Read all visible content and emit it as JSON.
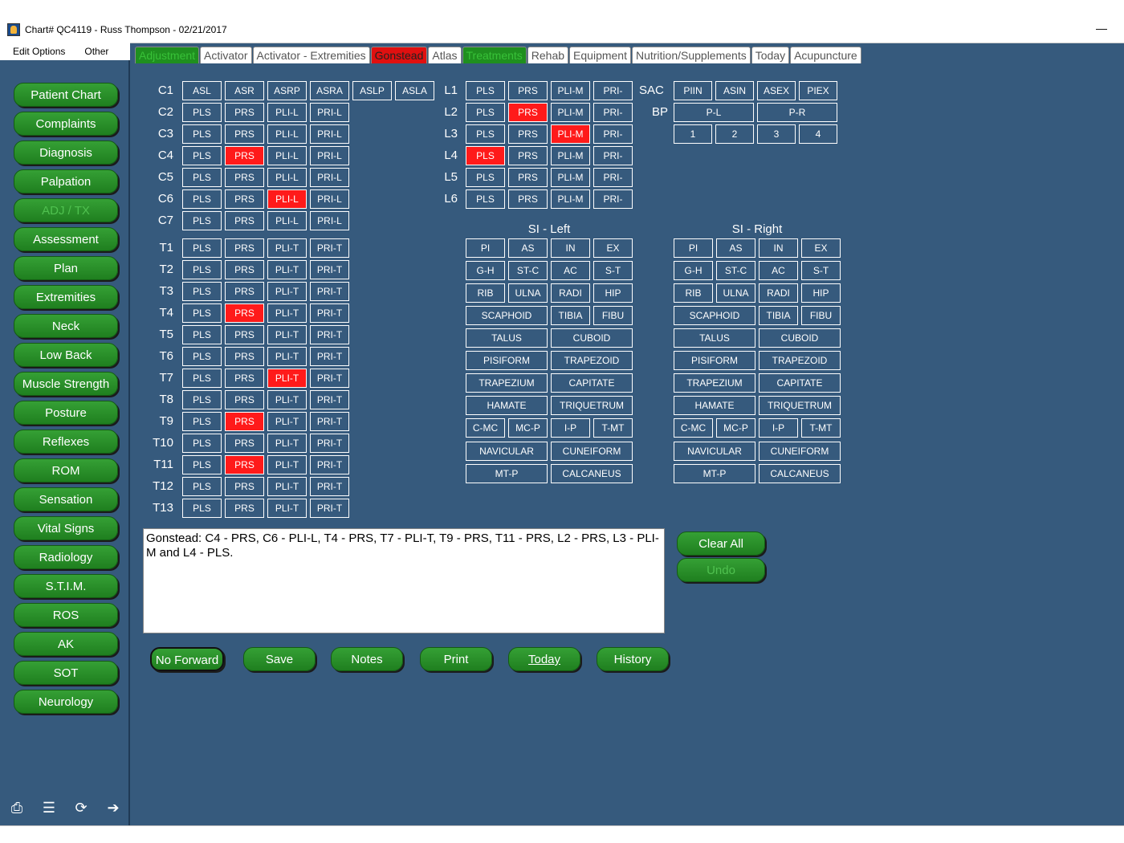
{
  "window": {
    "title": "Chart# QC4119 - Russ Thompson - 02/21/2017",
    "minimize": "—"
  },
  "menu": {
    "items": [
      "Edit Options",
      "Other"
    ]
  },
  "sidebar": {
    "items": [
      {
        "label": "Patient Chart"
      },
      {
        "label": "Complaints"
      },
      {
        "label": "Diagnosis"
      },
      {
        "label": "Palpation"
      },
      {
        "label": "ADJ / TX",
        "disabled": true
      },
      {
        "label": "Assessment"
      },
      {
        "label": "Plan"
      },
      {
        "label": "Extremities"
      },
      {
        "label": "Neck"
      },
      {
        "label": "Low Back"
      },
      {
        "label": "Muscle Strength"
      },
      {
        "label": "Posture"
      },
      {
        "label": "Reflexes"
      },
      {
        "label": "ROM"
      },
      {
        "label": "Sensation"
      },
      {
        "label": "Vital Signs"
      },
      {
        "label": "Radiology"
      },
      {
        "label": "S.T.I.M."
      },
      {
        "label": "ROS"
      },
      {
        "label": "AK"
      },
      {
        "label": "SOT"
      },
      {
        "label": "Neurology"
      }
    ],
    "bottom_icons": [
      "printer-icon",
      "list-icon",
      "refresh-icon",
      "arrow-right-icon"
    ]
  },
  "tabs": [
    {
      "label": "Adjustment",
      "style": "green"
    },
    {
      "label": "Activator"
    },
    {
      "label": "Activator - Extremities"
    },
    {
      "label": "Gonstead",
      "style": "red",
      "active": true
    },
    {
      "label": "Atlas"
    },
    {
      "label": "Treatments",
      "style": "green"
    },
    {
      "label": "Rehab"
    },
    {
      "label": "Equipment"
    },
    {
      "label": "Nutrition/Supplements"
    },
    {
      "label": "Today"
    },
    {
      "label": "Acupuncture"
    }
  ],
  "cervical": [
    {
      "label": "C1",
      "cells": [
        "ASL",
        "ASR",
        "ASRP",
        "ASRA",
        "ASLP",
        "ASLA"
      ],
      "selected": []
    },
    {
      "label": "C2",
      "cells": [
        "PLS",
        "PRS",
        "PLI-L",
        "PRI-L"
      ],
      "selected": []
    },
    {
      "label": "C3",
      "cells": [
        "PLS",
        "PRS",
        "PLI-L",
        "PRI-L"
      ],
      "selected": []
    },
    {
      "label": "C4",
      "cells": [
        "PLS",
        "PRS",
        "PLI-L",
        "PRI-L"
      ],
      "selected": [
        1
      ]
    },
    {
      "label": "C5",
      "cells": [
        "PLS",
        "PRS",
        "PLI-L",
        "PRI-L"
      ],
      "selected": []
    },
    {
      "label": "C6",
      "cells": [
        "PLS",
        "PRS",
        "PLI-L",
        "PRI-L"
      ],
      "selected": [
        2
      ]
    },
    {
      "label": "C7",
      "cells": [
        "PLS",
        "PRS",
        "PLI-L",
        "PRI-L"
      ],
      "selected": []
    }
  ],
  "thoracic": [
    {
      "label": "T1",
      "cells": [
        "PLS",
        "PRS",
        "PLI-T",
        "PRI-T"
      ],
      "selected": []
    },
    {
      "label": "T2",
      "cells": [
        "PLS",
        "PRS",
        "PLI-T",
        "PRI-T"
      ],
      "selected": []
    },
    {
      "label": "T3",
      "cells": [
        "PLS",
        "PRS",
        "PLI-T",
        "PRI-T"
      ],
      "selected": []
    },
    {
      "label": "T4",
      "cells": [
        "PLS",
        "PRS",
        "PLI-T",
        "PRI-T"
      ],
      "selected": [
        1
      ]
    },
    {
      "label": "T5",
      "cells": [
        "PLS",
        "PRS",
        "PLI-T",
        "PRI-T"
      ],
      "selected": []
    },
    {
      "label": "T6",
      "cells": [
        "PLS",
        "PRS",
        "PLI-T",
        "PRI-T"
      ],
      "selected": []
    },
    {
      "label": "T7",
      "cells": [
        "PLS",
        "PRS",
        "PLI-T",
        "PRI-T"
      ],
      "selected": [
        2
      ]
    },
    {
      "label": "T8",
      "cells": [
        "PLS",
        "PRS",
        "PLI-T",
        "PRI-T"
      ],
      "selected": []
    },
    {
      "label": "T9",
      "cells": [
        "PLS",
        "PRS",
        "PLI-T",
        "PRI-T"
      ],
      "selected": [
        1
      ]
    },
    {
      "label": "T10",
      "cells": [
        "PLS",
        "PRS",
        "PLI-T",
        "PRI-T"
      ],
      "selected": []
    },
    {
      "label": "T11",
      "cells": [
        "PLS",
        "PRS",
        "PLI-T",
        "PRI-T"
      ],
      "selected": [
        1
      ]
    },
    {
      "label": "T12",
      "cells": [
        "PLS",
        "PRS",
        "PLI-T",
        "PRI-T"
      ],
      "selected": []
    },
    {
      "label": "T13",
      "cells": [
        "PLS",
        "PRS",
        "PLI-T",
        "PRI-T"
      ],
      "selected": []
    }
  ],
  "lumbar": [
    {
      "label": "L1",
      "cells": [
        "PLS",
        "PRS",
        "PLI-M",
        "PRI-"
      ],
      "selected": []
    },
    {
      "label": "L2",
      "cells": [
        "PLS",
        "PRS",
        "PLI-M",
        "PRI-"
      ],
      "selected": [
        1
      ]
    },
    {
      "label": "L3",
      "cells": [
        "PLS",
        "PRS",
        "PLI-M",
        "PRI-"
      ],
      "selected": [
        2
      ]
    },
    {
      "label": "L4",
      "cells": [
        "PLS",
        "PRS",
        "PLI-M",
        "PRI-"
      ],
      "selected": [
        0
      ]
    },
    {
      "label": "L5",
      "cells": [
        "PLS",
        "PRS",
        "PLI-M",
        "PRI-"
      ],
      "selected": []
    },
    {
      "label": "L6",
      "cells": [
        "PLS",
        "PRS",
        "PLI-M",
        "PRI-"
      ],
      "selected": []
    }
  ],
  "sacrum": {
    "sac_label": "SAC",
    "sac_cells": [
      "PIIN",
      "ASIN",
      "ASEX",
      "PIEX"
    ],
    "bp_label": "BP",
    "bp_cells": [
      "P-L",
      "P-R"
    ],
    "num_cells": [
      "1",
      "2",
      "3",
      "4"
    ]
  },
  "si_left": {
    "title": "SI - Left",
    "rows": [
      [
        "PI",
        "AS",
        "IN",
        "EX"
      ],
      [
        "G-H",
        "ST-C",
        "AC",
        "S-T"
      ],
      [
        "RIB",
        "ULNA",
        "RADI",
        "HIP"
      ],
      [
        "SCAPHOID",
        "TIBIA",
        "FIBU"
      ],
      [
        "TALUS",
        "CUBOID"
      ],
      [
        "PISIFORM",
        "TRAPEZOID"
      ],
      [
        "TRAPEZIUM",
        "CAPITATE"
      ],
      [
        "HAMATE",
        "TRIQUETRUM"
      ],
      [
        "C-MC",
        "MC-P",
        "I-P",
        "T-MT"
      ],
      [
        "NAVICULAR",
        "CUNEIFORM"
      ],
      [
        "MT-P",
        "CALCANEUS"
      ]
    ]
  },
  "si_right": {
    "title": "SI - Right",
    "rows": [
      [
        "PI",
        "AS",
        "IN",
        "EX"
      ],
      [
        "G-H",
        "ST-C",
        "AC",
        "S-T"
      ],
      [
        "RIB",
        "ULNA",
        "RADI",
        "HIP"
      ],
      [
        "SCAPHOID",
        "TIBIA",
        "FIBU"
      ],
      [
        "TALUS",
        "CUBOID"
      ],
      [
        "PISIFORM",
        "TRAPEZOID"
      ],
      [
        "TRAPEZIUM",
        "CAPITATE"
      ],
      [
        "HAMATE",
        "TRIQUETRUM"
      ],
      [
        "C-MC",
        "MC-P",
        "I-P",
        "T-MT"
      ],
      [
        "NAVICULAR",
        "CUNEIFORM"
      ],
      [
        "MT-P",
        "CALCANEUS"
      ]
    ]
  },
  "notes": {
    "text": "Gonstead: C4 - PRS, C6 - PLI-L, T4 - PRS, T7 - PLI-T, T9 - PRS, T11 - PRS, L2 - PRS, L3 - PLI-M and L4 - PLS."
  },
  "side_actions": {
    "clear_all": "Clear All",
    "undo": "Undo"
  },
  "actions": {
    "no_forward": "No Forward",
    "save": "Save",
    "notes": "Notes",
    "print": "Print",
    "today": "Today",
    "history": "History"
  },
  "colors": {
    "panel": "#365a7d",
    "selected": "#ff1a1a",
    "button_green": "#2a8f2a"
  }
}
